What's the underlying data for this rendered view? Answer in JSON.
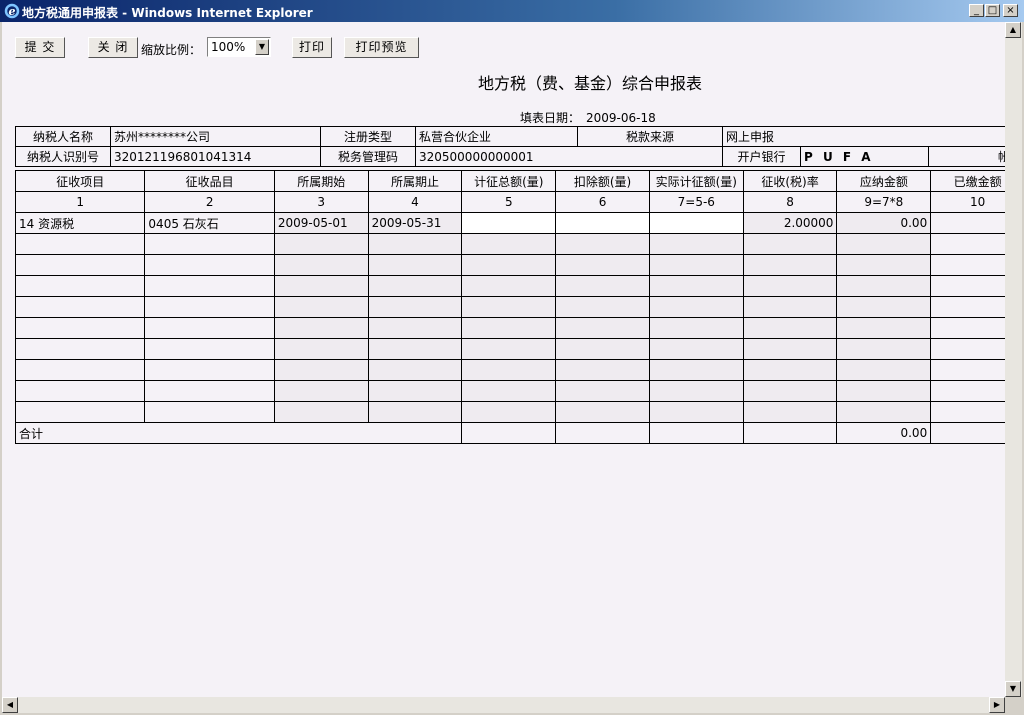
{
  "window": {
    "title": "地方税通用申报表 - Windows Internet Explorer",
    "minimize": "_",
    "maximize": "□",
    "close": "×"
  },
  "toolbar": {
    "submit_label": "提 交",
    "close_label": "关 闭",
    "zoom_label": "缩放比例：",
    "zoom_value": "100%",
    "print_label": "打印",
    "print_preview_label": "打印预览"
  },
  "form": {
    "title": "地方税（费、基金）综合申报表",
    "fill_date_label": "填表日期：",
    "fill_date": "2009-06-18"
  },
  "info": {
    "taxpayer_name_label": "纳税人名称",
    "taxpayer_name": "苏州********公司",
    "reg_type_label": "注册类型",
    "reg_type": "私营合伙企业",
    "tax_source_label": "税款来源",
    "tax_source": "网上申报",
    "taxpayer_id_label": "纳税人识别号",
    "taxpayer_id": "320121196801041314",
    "tax_mgmt_code_label": "税务管理码",
    "tax_mgmt_code": "320500000000001",
    "bank_label": "开户银行",
    "bank": "P U F A",
    "account_label": "帐号"
  },
  "table": {
    "headers": [
      "征收项目",
      "征收品目",
      "所属期始",
      "所属期止",
      "计征总额(量)",
      "扣除额(量)",
      "实际计征额(量)",
      "征收(税)率",
      "应纳金额",
      "已缴金额"
    ],
    "numbers": [
      "1",
      "2",
      "3",
      "4",
      "5",
      "6",
      "7=5-6",
      "8",
      "9=7*8",
      "10"
    ],
    "row1": {
      "item": "14 资源税",
      "subitem": "0405 石灰石",
      "period_start": "2009-05-01",
      "period_end": "2009-05-31",
      "rate": "2.00000",
      "payable": "0.00"
    },
    "total_label": "合计",
    "total_payable": "0.00"
  }
}
